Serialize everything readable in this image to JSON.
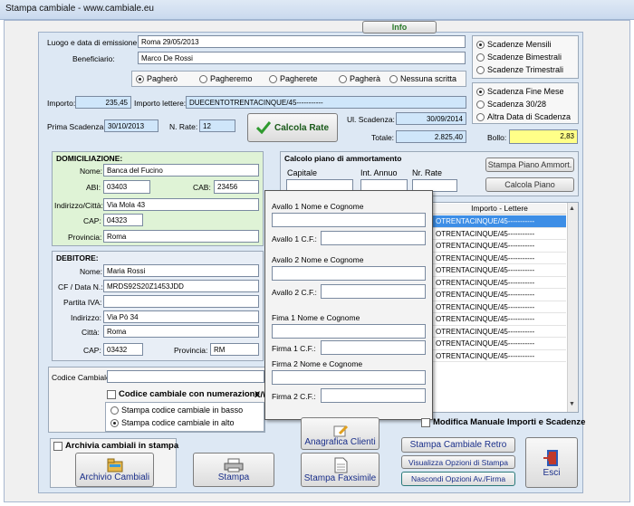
{
  "window": {
    "title": "Stampa cambiale - www.cambiale.eu"
  },
  "info_button": "Info",
  "emission": {
    "label": "Luogo e data di emissione:",
    "value": "Roma 29/05/2013"
  },
  "beneficiary": {
    "label": "Beneficiario:",
    "value": "Marco De Rossi"
  },
  "payment_options": [
    "Pagherò",
    "Pagheremo",
    "Pagherete",
    "Pagherà",
    "Nessuna scritta"
  ],
  "payment_selected": 0,
  "deadline_types": [
    "Scadenze Mensili",
    "Scadenze Bimestrali",
    "Scadenze Trimestrali"
  ],
  "deadline_type_selected": 0,
  "deadline_day": [
    "Scadenza Fine Mese",
    "Scadenza 30/28",
    "Altra Data di Scadenza"
  ],
  "deadline_day_selected": 0,
  "importo": {
    "label": "Importo:",
    "value": "235,45"
  },
  "importo_lettere": {
    "label": "Importo lettere:",
    "value": "DUECENTOTRENTACINQUE/45-----------"
  },
  "prima_scadenza": {
    "label": "Prima Scadenza:",
    "value": "30/10/2013"
  },
  "n_rate": {
    "label": "N. Rate:",
    "value": "12"
  },
  "calcola_rate": "Calcola Rate",
  "ul_scadenza": {
    "label": "Ul. Scadenza:",
    "value": "30/09/2014"
  },
  "totale": {
    "label": "Totale:",
    "value": "2.825,40"
  },
  "bollo": {
    "label": "Bollo:",
    "value": "2,83"
  },
  "domiciliazione": {
    "title": "DOMICILIAZIONE:",
    "nome_label": "Nome:",
    "nome": "Banca del Fucino",
    "abi_label": "ABI:",
    "abi": "03403",
    "cab_label": "CAB:",
    "cab": "23456",
    "indirizzo_label": "Indirizzo/Città:",
    "indirizzo": "Via Mola 43",
    "cap_label": "CAP:",
    "cap": "04323",
    "provincia_label": "Provincia:",
    "provincia": "Roma"
  },
  "debitore": {
    "title": "DEBITORE:",
    "nome_label": "Nome:",
    "nome": "Maria Rossi",
    "cf_label": "CF / Data N.:",
    "cf": "MRDS92S20Z1453JDD",
    "piva_label": "Partita IVA:",
    "piva": "",
    "indirizzo_label": "Indirizzo:",
    "indirizzo": "Via Pò 34",
    "citta_label": "Città:",
    "citta": "Roma",
    "cap_label": "CAP:",
    "cap": "03432",
    "provincia_label": "Provincia:",
    "provincia": "RM"
  },
  "piano": {
    "title": "Calcolo piano di ammortamento",
    "capitale": "Capitale",
    "int_annuo": "Int. Annuo",
    "nr_rate": "Nr. Rate",
    "stampa_btn": "Stampa Piano Ammort.",
    "calcola_btn": "Calcola Piano"
  },
  "table": {
    "header": "Importo - Lettere",
    "rows": [
      "OTRENTACINQUE/45-----------",
      "OTRENTACINQUE/45-----------",
      "OTRENTACINQUE/45-----------",
      "OTRENTACINQUE/45-----------",
      "OTRENTACINQUE/45-----------",
      "OTRENTACINQUE/45-----------",
      "OTRENTACINQUE/45-----------",
      "OTRENTACINQUE/45-----------",
      "OTRENTACINQUE/45-----------",
      "OTRENTACINQUE/45-----------",
      "OTRENTACINQUE/45-----------",
      "OTRENTACINQUE/45-----------"
    ]
  },
  "avalli": {
    "avallo1_nome": "Avallo 1 Nome e Cognome",
    "avallo1_cf": "Avallo 1 C.F.:",
    "avallo2_nome": "Avallo 2 Nome e Cognome",
    "avallo2_cf": "Avallo 2 C.F.:",
    "firma1_nome": "Fima 1 Nome e Cognome",
    "firma1_cf": "Firma 1 C.F.:",
    "firma2_nome": "Firma 2 Nome e Cognome",
    "firma2_cf": "Firma 2 C.F.:"
  },
  "codice": {
    "label": "Codice Cambiale:",
    "value": "",
    "numerazione": "Codice cambiale con numerazione",
    "numerazione_suffix": "X/\\",
    "pos_options": [
      "Stampa codice cambiale in basso",
      "Stampa codice cambiale in alto"
    ],
    "pos_selected": 1
  },
  "modifica_manuale": "Modifica Manuale Importi e Scadenze",
  "archivia": "Archivia cambiali in stampa",
  "buttons": {
    "archivio": "Archivio Cambiali",
    "stampa": "Stampa",
    "anagrafica": "Anagrafica Clienti",
    "faxsimile": "Stampa Faxsimile",
    "retro": "Stampa Cambiale Retro",
    "visualizza": "Visualizza Opzioni di Stampa",
    "nascondi": "Nascondi Opzioni Av./Firma",
    "esci": "Esci"
  },
  "colors": {
    "field_blue": "#cfe6fa",
    "bollo_yellow": "#ffff88",
    "green_panel": "#dff3d6",
    "selection": "#3d8ee6",
    "button_text": "#1a2f8a"
  }
}
